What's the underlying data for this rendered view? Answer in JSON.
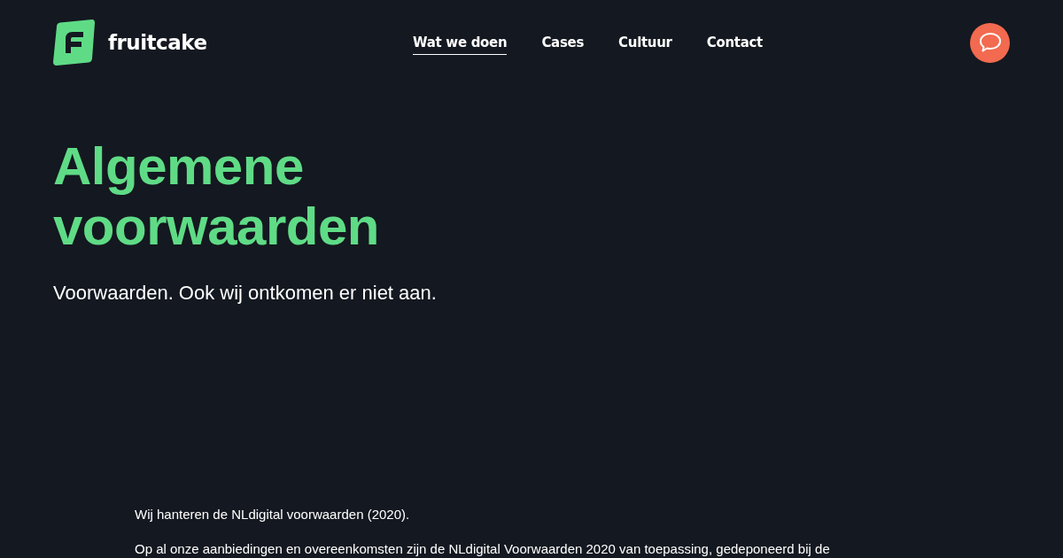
{
  "header": {
    "logo_text": "fruitcake",
    "nav": [
      {
        "label": "Wat we doen",
        "selected": true
      },
      {
        "label": "Cases",
        "selected": false
      },
      {
        "label": "Cultuur",
        "selected": false
      },
      {
        "label": "Contact",
        "selected": false
      }
    ]
  },
  "hero": {
    "title": "Algemene voorwaarden",
    "subtitle": "Voorwaarden. Ook wij ontkomen er niet aan."
  },
  "content": {
    "paragraphs": [
      "Wij hanteren de NLdigital voorwaarden (2020).",
      "Op al onze aanbiedingen en overeenkomsten zijn de NLdigital Voorwaarden 2020 van toepassing, gedeponeerd bij de"
    ]
  }
}
